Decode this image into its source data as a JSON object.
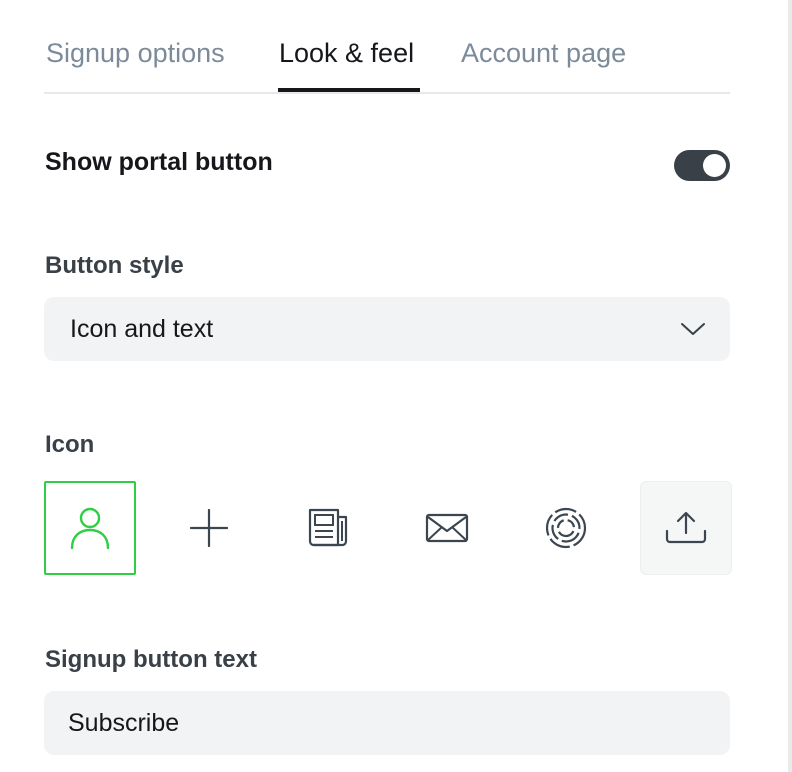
{
  "tabs": [
    {
      "label": "Signup options",
      "active": false
    },
    {
      "label": "Look & feel",
      "active": true
    },
    {
      "label": "Account page",
      "active": false
    }
  ],
  "portal_toggle": {
    "label": "Show portal button",
    "enabled": true
  },
  "button_style": {
    "label": "Button style",
    "selected": "Icon and text"
  },
  "icon_picker": {
    "label": "Icon",
    "options": [
      {
        "icon": "user-icon",
        "selected": true
      },
      {
        "icon": "plus-icon",
        "selected": false
      },
      {
        "icon": "newspaper-icon",
        "selected": false
      },
      {
        "icon": "envelope-icon",
        "selected": false
      },
      {
        "icon": "fingerprint-circle-icon",
        "selected": false
      },
      {
        "icon": "upload-icon",
        "selected": false
      }
    ]
  },
  "signup_text": {
    "label": "Signup button text",
    "value": "Subscribe"
  },
  "colors": {
    "accent_selected": "#30cf43",
    "toggle_on": "#394047",
    "tab_inactive": "#7c8b9a",
    "field_bg": "#f2f3f4"
  }
}
